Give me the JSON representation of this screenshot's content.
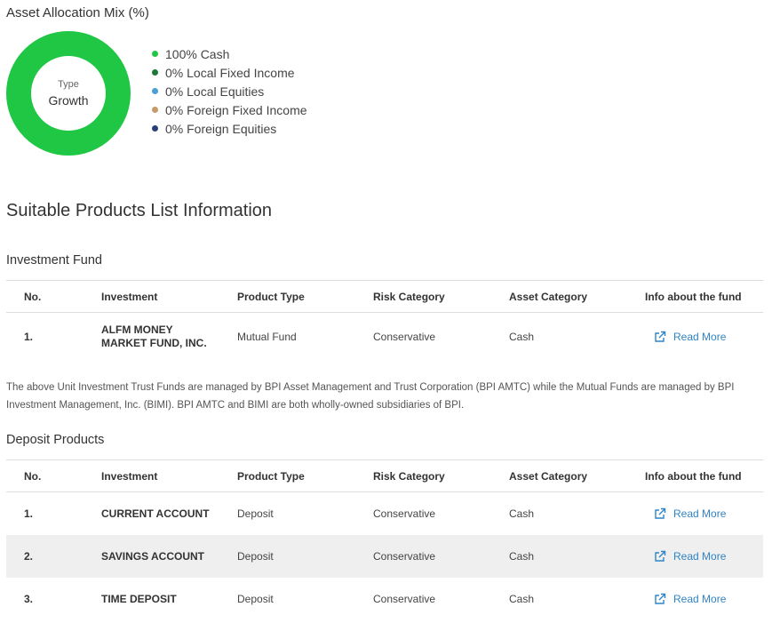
{
  "allocation": {
    "title": "Asset Allocation Mix (%)",
    "donut_type_label": "Type",
    "donut_type_value": "Growth",
    "legend": [
      {
        "label": "100% Cash",
        "color": "#1fc744"
      },
      {
        "label": "0% Local Fixed Income",
        "color": "#1d7a36"
      },
      {
        "label": "0% Local Equities",
        "color": "#4a9fd6"
      },
      {
        "label": "0% Foreign Fixed Income",
        "color": "#c79a6a"
      },
      {
        "label": "0% Foreign Equities",
        "color": "#2b3f7a"
      }
    ],
    "donut_color": "#1fc744"
  },
  "section_title": "Suitable Products List Information",
  "headers": {
    "no": "No.",
    "investment": "Investment",
    "product_type": "Product Type",
    "risk_category": "Risk Category",
    "asset_category": "Asset Category",
    "info": "Info about the fund"
  },
  "investment_fund": {
    "title": "Investment Fund",
    "rows": [
      {
        "no": "1.",
        "investment": "ALFM MONEY MARKET FUND, INC.",
        "product_type": "Mutual Fund",
        "risk": "Conservative",
        "asset": "Cash",
        "link": "Read More"
      }
    ]
  },
  "note": "The above Unit Investment Trust Funds are managed by BPI Asset Management and Trust Corporation (BPI AMTC) while the Mutual Funds are managed by BPI Investment Management, Inc. (BIMI). BPI AMTC and BIMI are both wholly-owned subsidiaries of BPI.",
  "deposit_products": {
    "title": "Deposit Products",
    "rows": [
      {
        "no": "1.",
        "investment": "CURRENT ACCOUNT",
        "product_type": "Deposit",
        "risk": "Conservative",
        "asset": "Cash",
        "link": "Read More"
      },
      {
        "no": "2.",
        "investment": "SAVINGS ACCOUNT",
        "product_type": "Deposit",
        "risk": "Conservative",
        "asset": "Cash",
        "link": "Read More"
      },
      {
        "no": "3.",
        "investment": "TIME DEPOSIT",
        "product_type": "Deposit",
        "risk": "Conservative",
        "asset": "Cash",
        "link": "Read More"
      }
    ]
  }
}
